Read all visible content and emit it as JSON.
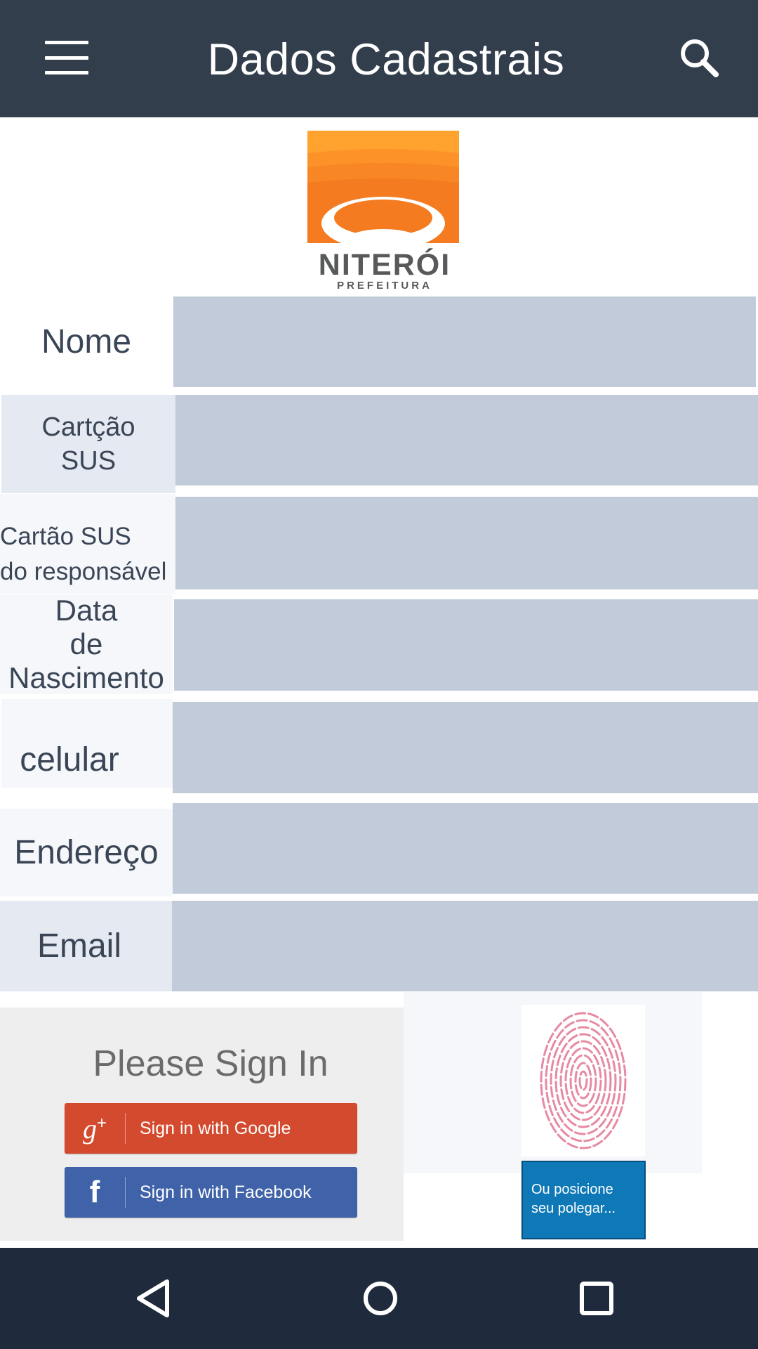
{
  "app_bar": {
    "title": "Dados Cadastrais",
    "menu_icon": "hamburger-menu-icon",
    "search_icon": "search-icon",
    "background": "#333e4c"
  },
  "logo": {
    "name": "NITERÓI",
    "subtitle": "PREFEITURA",
    "colors": [
      "#ffa22e",
      "#f47b20",
      "#58595b"
    ]
  },
  "form": {
    "fields": [
      {
        "label": "Nome",
        "value": ""
      },
      {
        "label": "Cartção\nSUS",
        "value": ""
      },
      {
        "label": "Cartão SUS\ndo responsável",
        "value": ""
      },
      {
        "label": "Data\nde\nNascimento",
        "value": ""
      },
      {
        "label": "celular",
        "value": ""
      },
      {
        "label": "Endereço",
        "value": ""
      },
      {
        "label": "Email",
        "value": ""
      }
    ],
    "input_color": "#c1cbd9"
  },
  "signin": {
    "title": "Please Sign In",
    "google_label": "Sign in with Google",
    "google_icon": "google-plus-icon",
    "google_color": "#d34a2e",
    "facebook_label": "Sign in with Facebook",
    "facebook_icon": "facebook-icon",
    "facebook_color": "#3f62a9"
  },
  "fingerprint": {
    "icon": "fingerprint-icon",
    "button_label": "Ou posicione\nseu polegar...",
    "button_color": "#0f79b8"
  },
  "nav_bar": {
    "back_icon": "back-triangle-icon",
    "home_icon": "home-circle-icon",
    "recents_icon": "recents-square-icon"
  }
}
